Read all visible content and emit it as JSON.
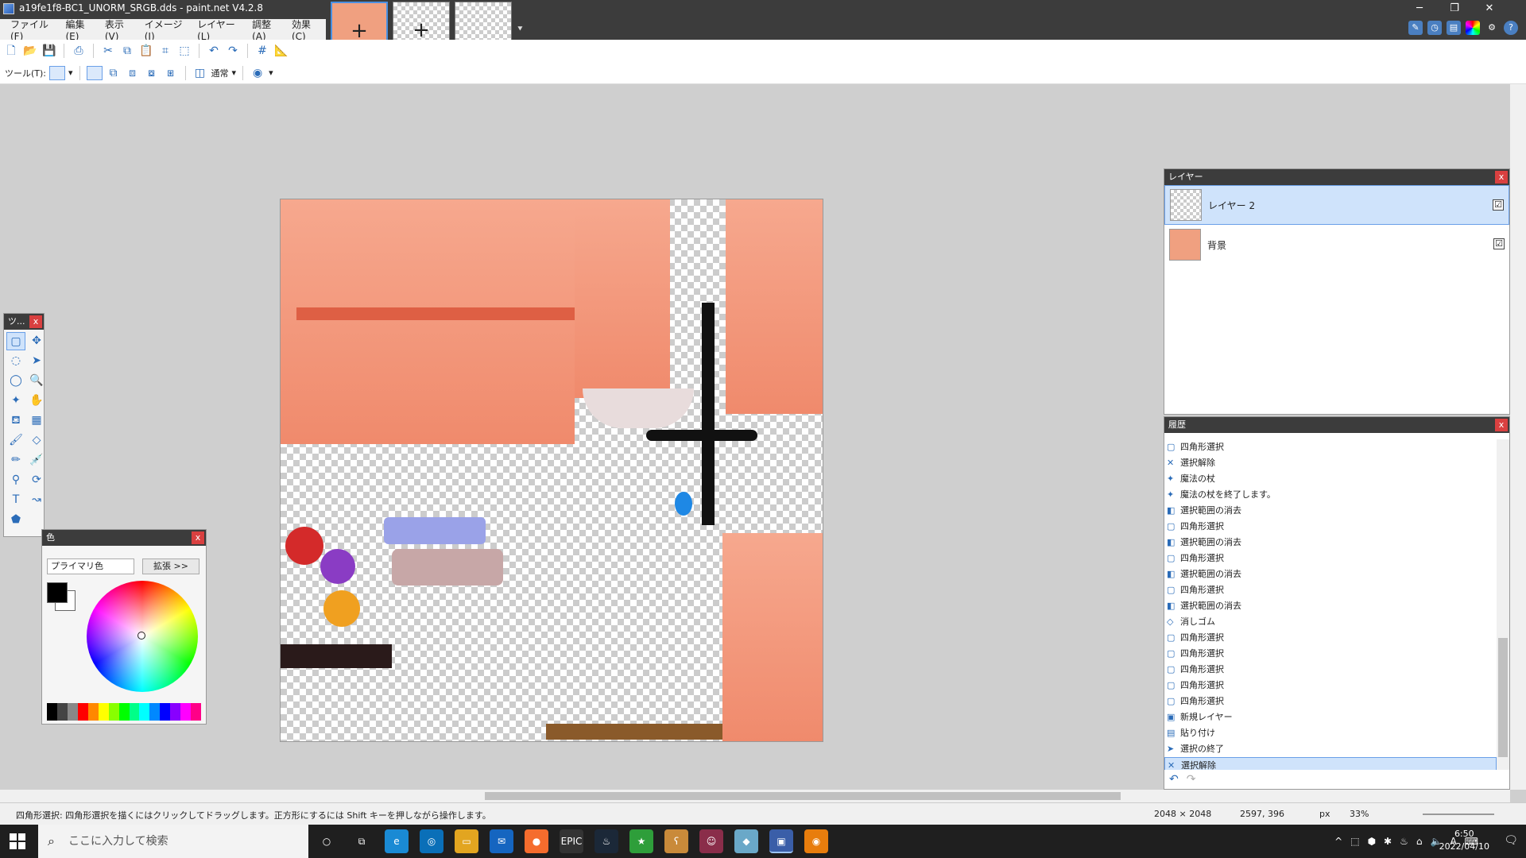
{
  "window": {
    "title": "a19fe1f8-BC1_UNORM_SRGB.dds - paint.net V4.2.8",
    "minimize": "─",
    "restore": "❐",
    "close": "✕"
  },
  "menu": [
    "ファイル(F)",
    "編集(E)",
    "表示(V)",
    "イメージ(I)",
    "レイヤー(L)",
    "調整(A)",
    "効果(C)"
  ],
  "toolbar": {
    "tool_label": "ツール(T):",
    "blend_mode": "通常"
  },
  "tools_panel": {
    "title": "ツ...",
    "close": "x"
  },
  "color_panel": {
    "title": "色",
    "close": "x",
    "mode": "プライマリ色",
    "expand": "拡張 >>",
    "primary_color": "#000000",
    "secondary_color": "#ffffff"
  },
  "layers_panel": {
    "title": "レイヤー",
    "close": "x",
    "layers": [
      {
        "name": "レイヤー 2",
        "visible": "☑",
        "selected": true
      },
      {
        "name": "背景",
        "visible": "☑",
        "selected": false
      }
    ]
  },
  "history_panel": {
    "title": "履歴",
    "close": "x",
    "items": [
      {
        "label": "四角形選択",
        "icon": "▢"
      },
      {
        "label": "選択解除",
        "icon": "✕"
      },
      {
        "label": "魔法の杖",
        "icon": "✦"
      },
      {
        "label": "魔法の杖を終了します。",
        "icon": "✦"
      },
      {
        "label": "選択範囲の消去",
        "icon": "◧"
      },
      {
        "label": "四角形選択",
        "icon": "▢"
      },
      {
        "label": "選択範囲の消去",
        "icon": "◧"
      },
      {
        "label": "四角形選択",
        "icon": "▢"
      },
      {
        "label": "選択範囲の消去",
        "icon": "◧"
      },
      {
        "label": "四角形選択",
        "icon": "▢"
      },
      {
        "label": "選択範囲の消去",
        "icon": "◧"
      },
      {
        "label": "消しゴム",
        "icon": "◇"
      },
      {
        "label": "四角形選択",
        "icon": "▢"
      },
      {
        "label": "四角形選択",
        "icon": "▢"
      },
      {
        "label": "四角形選択",
        "icon": "▢"
      },
      {
        "label": "四角形選択",
        "icon": "▢"
      },
      {
        "label": "四角形選択",
        "icon": "▢"
      },
      {
        "label": "新規レイヤー",
        "icon": "▣"
      },
      {
        "label": "貼り付け",
        "icon": "▤"
      },
      {
        "label": "選択の終了",
        "icon": "➤"
      },
      {
        "label": "選択解除",
        "icon": "✕"
      }
    ],
    "undo": "↶",
    "redo": "↷"
  },
  "status": {
    "hint": "四角形選択: 四角形選択を描くにはクリックしてドラッグします。正方形にするには Shift キーを押しながら操作します。",
    "image_size": "2048 × 2048",
    "cursor_pos": "2597, 396",
    "unit": "px",
    "zoom": "33%"
  },
  "taskbar": {
    "search_placeholder": "ここに入力して検索",
    "time": "6:50",
    "date": "2022/04/10",
    "ime": "A"
  }
}
